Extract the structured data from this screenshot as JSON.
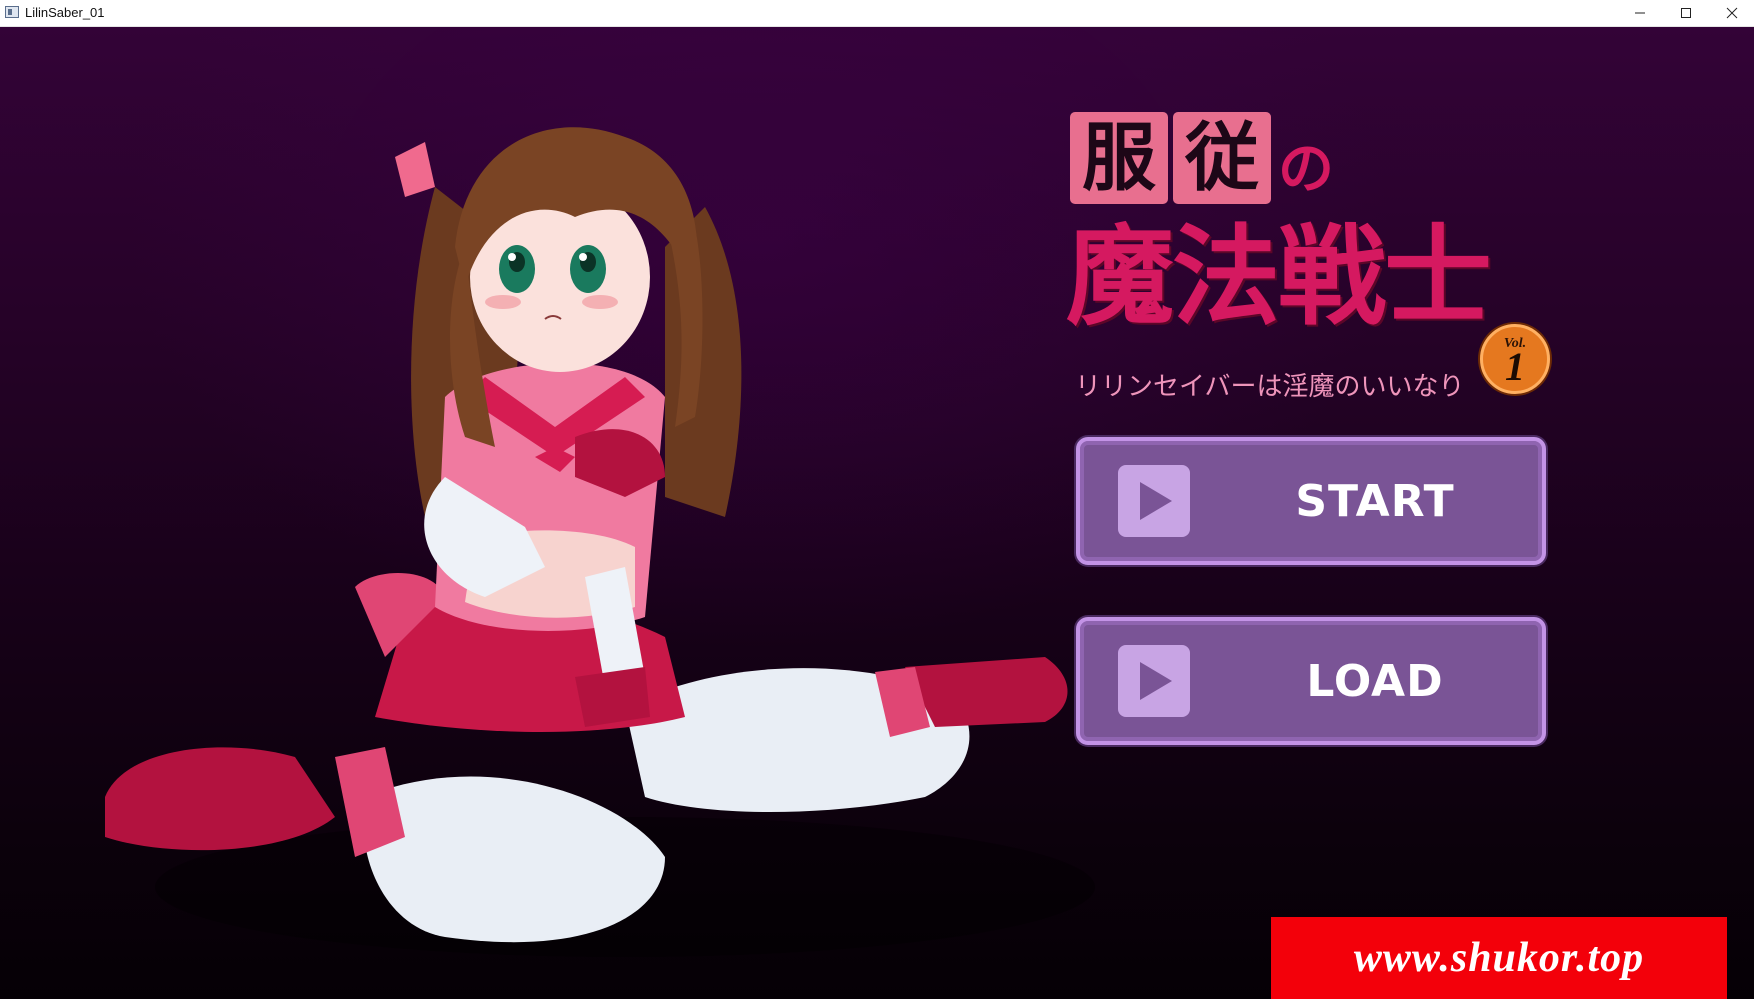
{
  "window": {
    "title": "LilinSaber_01",
    "controls": {
      "minimize": "minimize-icon",
      "maximize": "maximize-icon",
      "close": "close-icon"
    }
  },
  "logo": {
    "kanji_1": "服",
    "kanji_2": "従",
    "particle": "の",
    "main_title": "魔法戦士",
    "subtitle": "リリンセイバーは淫魔のいいなり",
    "vol_label": "Vol.",
    "vol_number": "1"
  },
  "menu": {
    "start_label": "START",
    "load_label": "LOAD"
  },
  "watermark": {
    "text": "www.shukor.top"
  },
  "colors": {
    "logo_accent": "#d51960",
    "logo_box": "#e86f8f",
    "button_fill": "#7a5496",
    "button_border": "#c393e6",
    "watermark_bg": "#f3000a",
    "background_top": "#330337",
    "background_bottom": "#050005"
  }
}
